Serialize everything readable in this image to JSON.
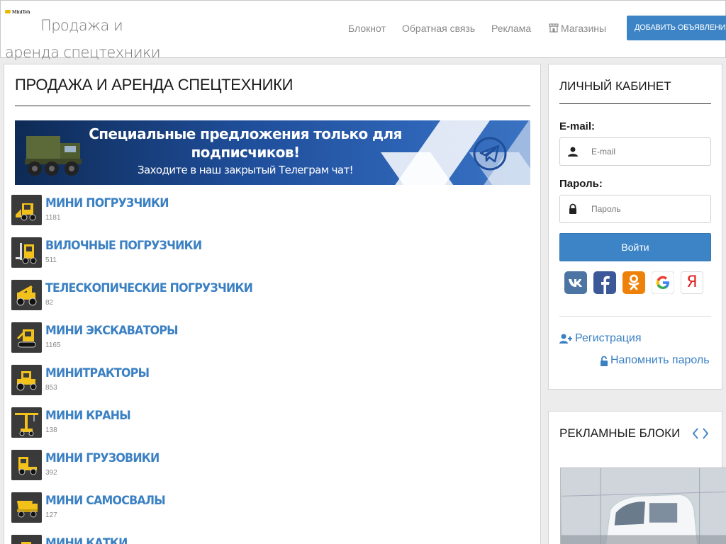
{
  "header": {
    "logo_text": "MiniTeh",
    "site_title": "Продажа и аренда спецтехники",
    "nav": [
      {
        "label": "Блокнот"
      },
      {
        "label": "Обратная связь"
      },
      {
        "label": "Реклама"
      },
      {
        "label": "Магазины"
      }
    ],
    "add_button": "Добавить объявление"
  },
  "main": {
    "title": "ПРОДАЖА И АРЕНДА СПЕЦТЕХНИКИ",
    "banner": {
      "line1": "Специальные предложения только для подписчиков!",
      "line2": "Заходите в наш закрытый Телеграм чат!"
    },
    "categories": [
      {
        "name": "МИНИ ПОГРУЗЧИКИ",
        "count": "1181",
        "icon": "mini-loader-icon"
      },
      {
        "name": "ВИЛОЧНЫЕ ПОГРУЗЧИКИ",
        "count": "511",
        "icon": "forklift-icon"
      },
      {
        "name": "ТЕЛЕСКОПИЧЕСКИЕ ПОГРУЗЧИКИ",
        "count": "82",
        "icon": "telescopic-loader-icon"
      },
      {
        "name": "МИНИ ЭКСКАВАТОРЫ",
        "count": "1165",
        "icon": "mini-excavator-icon"
      },
      {
        "name": "МИНИТРАКТОРЫ",
        "count": "853",
        "icon": "mini-tractor-icon"
      },
      {
        "name": "МИНИ КРАНЫ",
        "count": "138",
        "icon": "mini-crane-icon"
      },
      {
        "name": "МИНИ ГРУЗОВИКИ",
        "count": "392",
        "icon": "mini-truck-icon"
      },
      {
        "name": "МИНИ САМОСВАЛЫ",
        "count": "127",
        "icon": "mini-dump-truck-icon"
      },
      {
        "name": "МИНИ КАТКИ",
        "count": "",
        "icon": "mini-roller-icon"
      }
    ]
  },
  "account": {
    "title": "Личный кабинет",
    "email_label": "E-mail:",
    "email_placeholder": "E-mail",
    "password_label": "Пароль:",
    "password_placeholder": "Пароль",
    "login_button": "Войти",
    "social": [
      "vk-icon",
      "facebook-icon",
      "odnoklassniki-icon",
      "google-icon",
      "yandex-icon"
    ],
    "yandex_glyph": "Я",
    "register_link": "Регистрация",
    "remind_link": "Напомнить пароль"
  },
  "ads": {
    "title": "Рекламные блоки"
  },
  "colors": {
    "accent": "#3d84c6",
    "link": "#3a80c3",
    "category_icon_bg": "#3a3a3a",
    "category_icon_fg": "#f2c21b"
  }
}
